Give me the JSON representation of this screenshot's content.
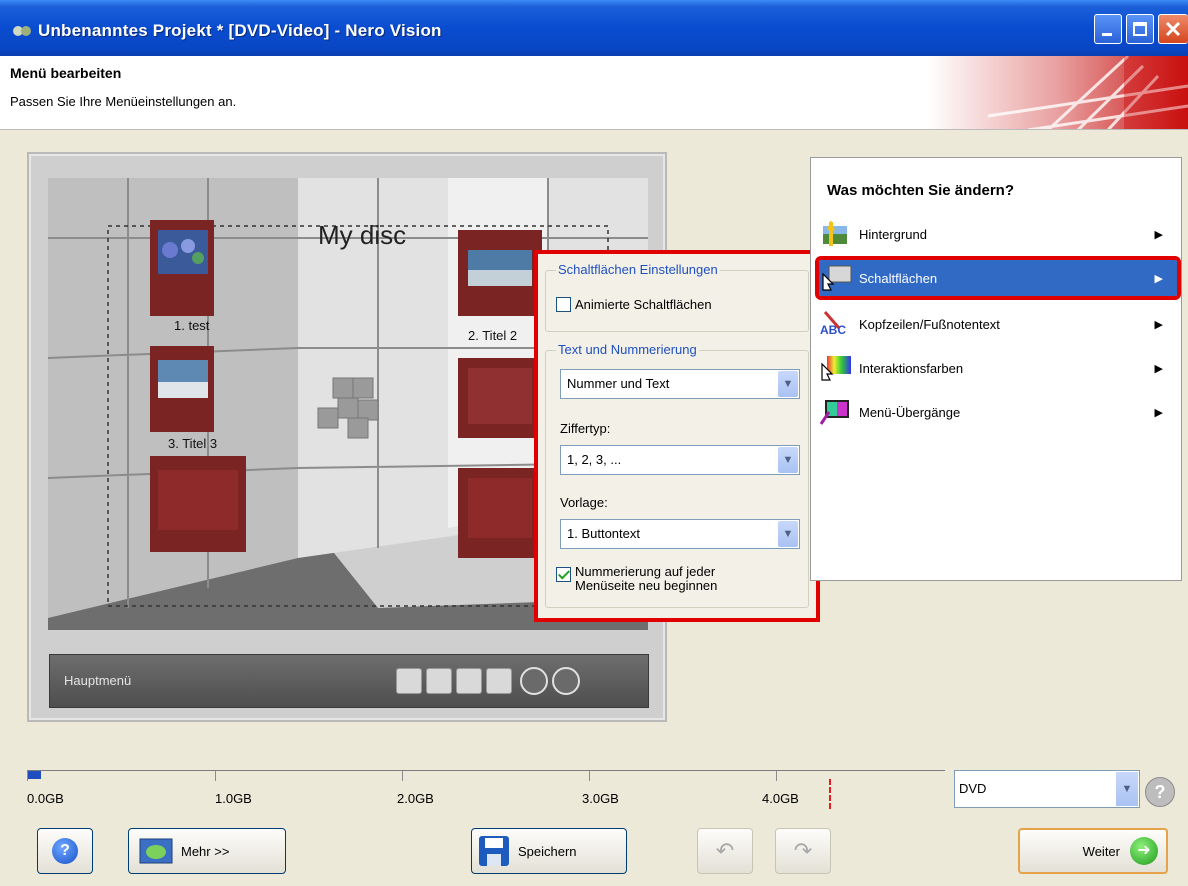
{
  "window": {
    "title": "Unbenanntes Projekt * [DVD-Video] - Nero Vision"
  },
  "header": {
    "title": "Menü bearbeiten",
    "subtitle": "Passen Sie Ihre Menüeinstellungen an."
  },
  "preview": {
    "disc_title": "My disc",
    "buttons": [
      "1. test",
      "2. Titel 2",
      "3. Titel 3"
    ],
    "bar_label": "Hauptmenü"
  },
  "button_settings": {
    "group1_title": "Schaltflächen Einstellungen",
    "animated_label": "Animierte Schaltflächen",
    "animated_checked": false,
    "group2_title": "Text und Nummerierung",
    "numbering_value": "Nummer und Text",
    "digit_type_label": "Ziffertyp:",
    "digit_type_value": "1, 2, 3, ...",
    "template_label": "Vorlage:",
    "template_value": "1. Buttontext",
    "restart_label": "Nummerierung auf jeder Menüseite neu beginnen",
    "restart_checked": true
  },
  "right_panel": {
    "heading": "Was möchten Sie ändern?",
    "items": [
      {
        "label": "Hintergrund",
        "icon": "background-icon"
      },
      {
        "label": "Schaltflächen",
        "icon": "pointer-icon",
        "selected": true
      },
      {
        "label": "Kopfzeilen/Fußnotentext",
        "icon": "abc-text-icon"
      },
      {
        "label": "Interaktionsfarben",
        "icon": "color-pointer-icon"
      },
      {
        "label": "Menü-Übergänge",
        "icon": "transition-icon"
      }
    ]
  },
  "timeline": {
    "labels": [
      "0.0GB",
      "1.0GB",
      "2.0GB",
      "3.0GB",
      "4.0GB"
    ]
  },
  "disc_type": {
    "value": "DVD"
  },
  "bottom": {
    "mehr_label": "Mehr >>",
    "save_label": "Speichern",
    "next_label": "Weiter"
  },
  "colors": {
    "accent_red": "#e00000",
    "selection_blue": "#316ac5",
    "titlebar_blue": "#0a4cd0"
  }
}
